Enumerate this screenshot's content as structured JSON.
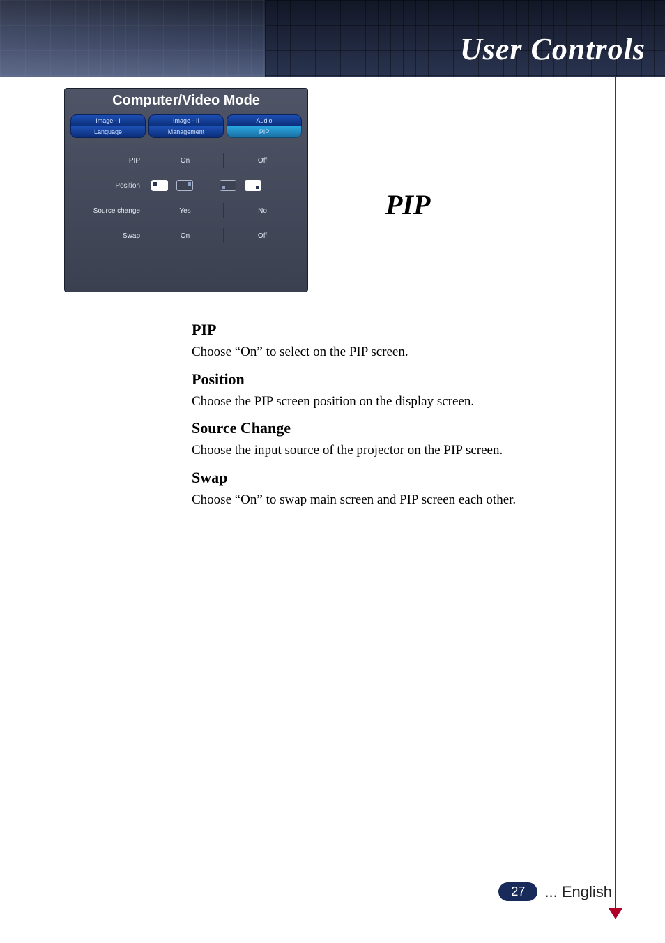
{
  "header": {
    "title": "User Controls"
  },
  "side_heading": "PIP",
  "osd": {
    "title": "Computer/Video Mode",
    "tabs_row1": [
      "Image - I",
      "Image - II",
      "Audio"
    ],
    "tabs_row2": [
      "Language",
      "Management",
      "PIP"
    ],
    "active_tab": "PIP",
    "rows": {
      "pip": {
        "label": "PIP",
        "opt1": "On",
        "opt2": "Off"
      },
      "pos": {
        "label": "Position"
      },
      "src": {
        "label": "Source change",
        "opt1": "Yes",
        "opt2": "No"
      },
      "swap": {
        "label": "Swap",
        "opt1": "On",
        "opt2": "Off"
      }
    }
  },
  "sections": {
    "pip": {
      "h": "PIP",
      "p": "Choose “On” to select on the PIP screen."
    },
    "pos": {
      "h": "Position",
      "p": "Choose the PIP screen position on the display screen."
    },
    "src": {
      "h": "Source Change",
      "p": "Choose the input source of the projector on the PIP screen."
    },
    "swap": {
      "h": "Swap",
      "p": "Choose “On” to swap main screen and PIP screen each other."
    }
  },
  "footer": {
    "page": "27",
    "lang": "... English"
  }
}
